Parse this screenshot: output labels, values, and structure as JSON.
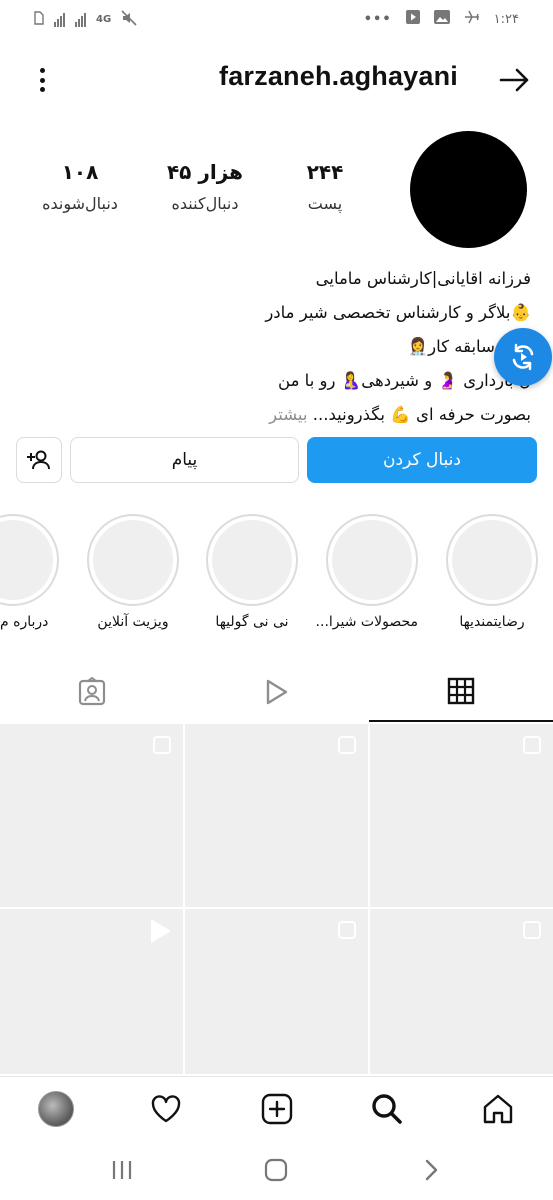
{
  "status_bar": {
    "time": "۱:۲۴",
    "network": "4G",
    "icons": [
      "sim-icon",
      "signal-icon",
      "signal-icon",
      "mute-icon",
      "more-dots-icon",
      "play-icon",
      "gallery-icon",
      "airplane-icon"
    ]
  },
  "header": {
    "username": "farzaneh.aghayani",
    "back_icon": "arrow-right-icon",
    "menu_icon": "vertical-dots-icon"
  },
  "stats": {
    "posts": {
      "value": "۲۴۴",
      "label": "پست"
    },
    "followers": {
      "value": "۴۵ هزار",
      "label": "دنبال‌کننده"
    },
    "following": {
      "value": "۱۰۸",
      "label": "دنبال‌شونده"
    }
  },
  "bio": {
    "line1": "فرزانه اقایانی|کارشناس مامایی",
    "line2": "👶بلاگر و کارشناس تخصصی شیر مادر",
    "line3": "سال سابقه کار👩‍⚕️",
    "line4": "ن بارداری 🤰 و شیردهی🤱 رو با من",
    "line5": "بصورت حرفه ای 💪 بگذرونید...",
    "more": "بیشتر"
  },
  "buttons": {
    "follow": "دنبال کردن",
    "message": "پیام"
  },
  "highlights": [
    {
      "label": "رضایتمندیها"
    },
    {
      "label": "محصولات شیرا..."
    },
    {
      "label": "نی نی گولیها"
    },
    {
      "label": "ویزیت آنلاین"
    },
    {
      "label": "درباره م"
    }
  ],
  "tabs": [
    "grid-icon",
    "reels-icon",
    "tagged-icon"
  ],
  "bottom_nav": [
    "home-icon",
    "search-icon",
    "create-icon",
    "heart-icon",
    "profile-avatar"
  ],
  "colors": {
    "accent": "#1e9bf0",
    "fab": "#1e88e5"
  }
}
